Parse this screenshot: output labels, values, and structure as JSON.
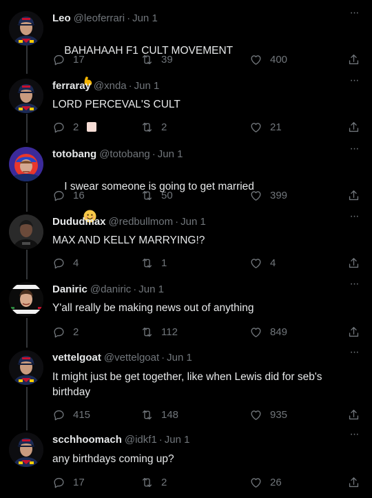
{
  "tweets": [
    {
      "name": "Leo",
      "handle": "@leoferrari",
      "date": "Jun 1",
      "text": "BAHAHAAH F1 CULT MOVEMENT",
      "emoji": [
        "flexed-biceps-emoji",
        "white-square-emoji"
      ],
      "replies": "17",
      "retweets": "39",
      "likes": "400",
      "avatar": "driver-red-bull-cap-avatar"
    },
    {
      "name": "ferraray",
      "handle": "@xnda",
      "date": "Jun 1",
      "text": "LORD PERCEVAL'S CULT",
      "replies": "2",
      "retweets": "2",
      "likes": "21",
      "avatar": "driver-red-bull-cap-avatar"
    },
    {
      "name": "totobang",
      "handle": "@totobang",
      "date": "Jun 1",
      "text": "I swear someone is going to get married",
      "emoji": [
        "smiling-face-emoji"
      ],
      "replies": "16",
      "retweets": "50",
      "likes": "399",
      "avatar": "driver-helmet-avatar"
    },
    {
      "name": "Dududmax",
      "handle": "@redbullmom",
      "date": "Jun 1",
      "text": "MAX AND KELLY MARRYING!?",
      "replies": "4",
      "retweets": "1",
      "likes": "4",
      "avatar": "driver-dark-photo-avatar"
    },
    {
      "name": "Daniric",
      "handle": "@daniric",
      "date": "Jun 1",
      "text": "Y'all really be making news out of anything",
      "replies": "2",
      "retweets": "112",
      "likes": "849",
      "avatar": "driver-banner-avatar"
    },
    {
      "name": "vettelgoat",
      "handle": "@vettelgoat",
      "date": "Jun 1",
      "text": "It might just be get together, like when Lewis did for seb's\nbirthday",
      "replies": "415",
      "retweets": "148",
      "likes": "935",
      "avatar": "driver-red-bull-cap-avatar"
    },
    {
      "name": "scchhoomach",
      "handle": "@idkf1",
      "date": "Jun 1",
      "text": "any birthdays coming up?",
      "replies": "17",
      "retweets": "2",
      "likes": "26",
      "avatar": "driver-red-bull-cap-avatar"
    }
  ],
  "separator": "·",
  "more_glyph": "···",
  "colors": {
    "background": "#000000",
    "text": "#e7e9ea",
    "muted": "#71767b",
    "line": "#333639"
  }
}
